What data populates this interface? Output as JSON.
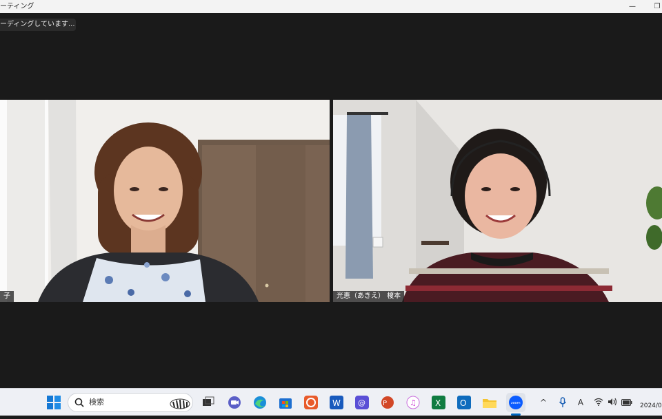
{
  "window": {
    "title": "ーティング",
    "minimize_glyph": "—",
    "restore_glyph": "❐"
  },
  "recording": {
    "label": "ーディングしています..."
  },
  "participants": [
    {
      "name": "子"
    },
    {
      "name": "光恵（あきえ） 榎本"
    }
  ],
  "taskbar": {
    "search_placeholder": "検索",
    "apps": [
      "start",
      "search",
      "task-view",
      "teams-chat",
      "edge",
      "microsoft-store",
      "arc-app",
      "word",
      "mail-app",
      "powerpoint",
      "itunes",
      "excel",
      "outlook",
      "file-explorer",
      "zoom"
    ],
    "tray": {
      "chevron": "^",
      "ime": "A",
      "date": "2024/0"
    }
  },
  "colors": {
    "accent": "#0067c0",
    "zoom_blue": "#0b5cff"
  }
}
